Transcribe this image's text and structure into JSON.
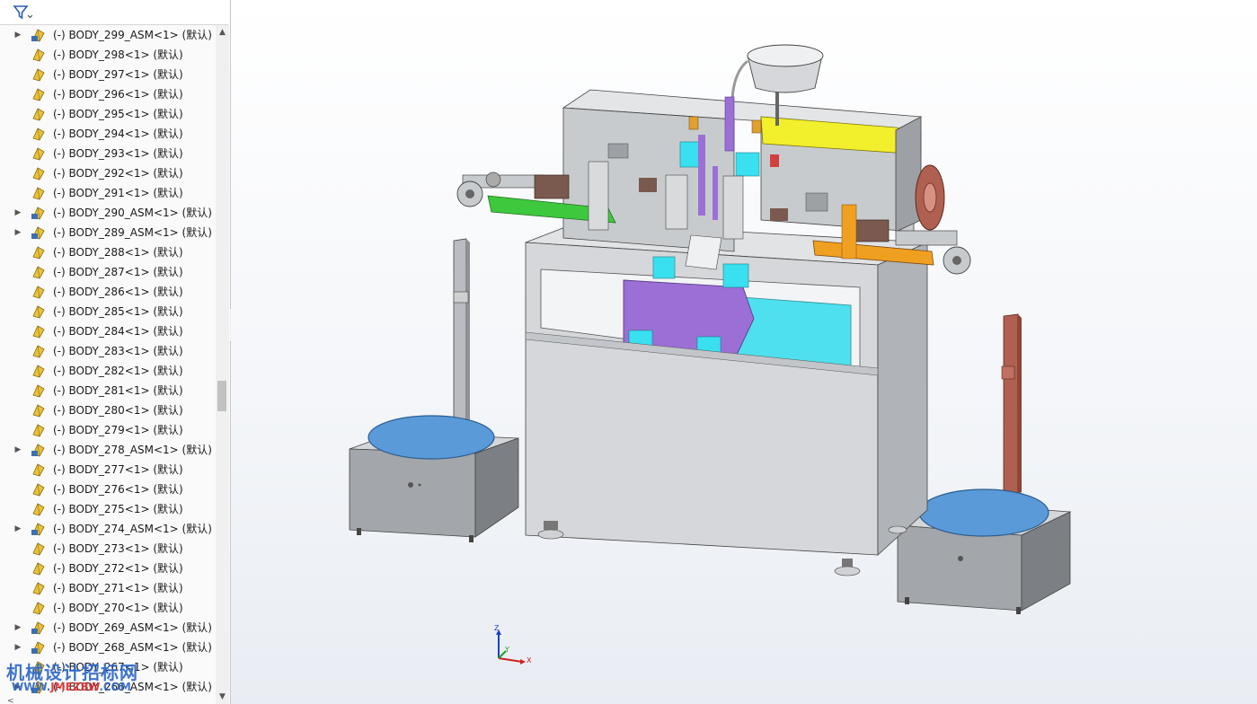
{
  "feature_tree": {
    "filter_icon": "funnel-filter-icon",
    "items": [
      {
        "label": "(-) BODY_299_ASM<1> (默认)",
        "expandable": true
      },
      {
        "label": "(-) BODY_298<1> (默认)",
        "expandable": false
      },
      {
        "label": "(-) BODY_297<1> (默认)",
        "expandable": false
      },
      {
        "label": "(-) BODY_296<1> (默认)",
        "expandable": false
      },
      {
        "label": "(-) BODY_295<1> (默认)",
        "expandable": false
      },
      {
        "label": "(-) BODY_294<1> (默认)",
        "expandable": false
      },
      {
        "label": "(-) BODY_293<1> (默认)",
        "expandable": false
      },
      {
        "label": "(-) BODY_292<1> (默认)",
        "expandable": false
      },
      {
        "label": "(-) BODY_291<1> (默认)",
        "expandable": false
      },
      {
        "label": "(-) BODY_290_ASM<1> (默认)",
        "expandable": true
      },
      {
        "label": "(-) BODY_289_ASM<1> (默认)",
        "expandable": true
      },
      {
        "label": "(-) BODY_288<1> (默认)",
        "expandable": false
      },
      {
        "label": "(-) BODY_287<1> (默认)",
        "expandable": false
      },
      {
        "label": "(-) BODY_286<1> (默认)",
        "expandable": false
      },
      {
        "label": "(-) BODY_285<1> (默认)",
        "expandable": false
      },
      {
        "label": "(-) BODY_284<1> (默认)",
        "expandable": false
      },
      {
        "label": "(-) BODY_283<1> (默认)",
        "expandable": false
      },
      {
        "label": "(-) BODY_282<1> (默认)",
        "expandable": false
      },
      {
        "label": "(-) BODY_281<1> (默认)",
        "expandable": false
      },
      {
        "label": "(-) BODY_280<1> (默认)",
        "expandable": false
      },
      {
        "label": "(-) BODY_279<1> (默认)",
        "expandable": false
      },
      {
        "label": "(-) BODY_278_ASM<1> (默认)",
        "expandable": true
      },
      {
        "label": "(-) BODY_277<1> (默认)",
        "expandable": false
      },
      {
        "label": "(-) BODY_276<1> (默认)",
        "expandable": false
      },
      {
        "label": "(-) BODY_275<1> (默认)",
        "expandable": false
      },
      {
        "label": "(-) BODY_274_ASM<1> (默认)",
        "expandable": true
      },
      {
        "label": "(-) BODY_273<1> (默认)",
        "expandable": false
      },
      {
        "label": "(-) BODY_272<1> (默认)",
        "expandable": false
      },
      {
        "label": "(-) BODY_271<1> (默认)",
        "expandable": false
      },
      {
        "label": "(-) BODY_270<1> (默认)",
        "expandable": false
      },
      {
        "label": "(-) BODY_269_ASM<1> (默认)",
        "expandable": true
      },
      {
        "label": "(-) BODY_268_ASM<1> (默认)",
        "expandable": true
      },
      {
        "label": "(-) BODY_267<1> (默认)",
        "expandable": false
      },
      {
        "label": "(-) BODY_266_ASM<1> (默认)",
        "expandable": true
      }
    ]
  },
  "watermark": {
    "line1": "机械设计招标网",
    "line2_blue": "WWW.",
    "line2_red": "JMEZBW",
    "line2_end": ".COM"
  },
  "triad": {
    "z": "Z",
    "y": "Y",
    "x": "X"
  },
  "colors": {
    "tree_icon_yellow": "#e8c33a",
    "tree_icon_blue": "#3c6fb0",
    "turntable_blue": "#5a9ad8",
    "accent_purple": "#9b6fd6",
    "accent_cyan": "#38e0f0",
    "accent_yellow": "#f2ef2c",
    "accent_green": "#3ec83e",
    "accent_orange": "#f0a020",
    "post_red": "#b06050"
  }
}
